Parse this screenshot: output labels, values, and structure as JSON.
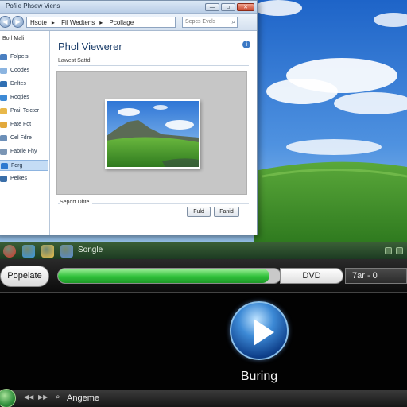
{
  "window": {
    "title": "Pofile Phsew Viens",
    "address": [
      "Hsdte",
      "Fil Wedtens",
      "Pcollage"
    ],
    "search_placeholder": "Sepcs Evcls",
    "buttons": [
      "—",
      "▫",
      "✕"
    ]
  },
  "sidebar": {
    "header": "Borl Mali",
    "items": [
      {
        "label": "Folpeis",
        "icon": "picture-folder-icon",
        "color": "#4a7fc1",
        "selected": false
      },
      {
        "label": "Coodes",
        "icon": "document-icon",
        "color": "#8bb4e0",
        "selected": false
      },
      {
        "label": "Dnltes",
        "icon": "network-icon",
        "color": "#2f6fb3",
        "selected": false
      },
      {
        "label": "Roqtles",
        "icon": "library-icon",
        "color": "#3d8ad6",
        "selected": false
      },
      {
        "label": "Prail Tclcter",
        "icon": "folder-icon",
        "color": "#e8b84a",
        "selected": false
      },
      {
        "label": "Fate Fot",
        "icon": "folder-icon",
        "color": "#e2a93c",
        "selected": false
      },
      {
        "label": "Cel Fdre",
        "icon": "drive-icon",
        "color": "#6c8fb8",
        "selected": false
      },
      {
        "label": "Fabrie Fhy",
        "icon": "drive-icon",
        "color": "#7b96b5",
        "selected": false
      },
      {
        "label": "Fdrg",
        "icon": "globe-icon",
        "color": "#2f7ad0",
        "selected": true
      },
      {
        "label": "Pelkes",
        "icon": "computer-icon",
        "color": "#3a6ea8",
        "selected": false
      }
    ]
  },
  "content": {
    "heading": "Phol Viewerer",
    "subheading": "Lawest Sattd",
    "footer_label": "Seport Dbte",
    "buttons": [
      "Fuld",
      "Fanid"
    ]
  },
  "taskbar": {
    "label": "Songle",
    "icons": [
      {
        "name": "browser-icon",
        "color": "#d63b2a"
      },
      {
        "name": "bird-icon",
        "color": "#3b9ae0"
      },
      {
        "name": "folder-icon",
        "color": "#e8c04a"
      },
      {
        "name": "photo-app-icon",
        "color": "#5a8ed0"
      }
    ]
  },
  "player": {
    "populate_label": "Popeiate",
    "progress": 0.95,
    "dvd_label": "DVD",
    "counter": "7ar - 0",
    "status": "Buring"
  },
  "bottom_bar": {
    "label": "Angeme"
  }
}
